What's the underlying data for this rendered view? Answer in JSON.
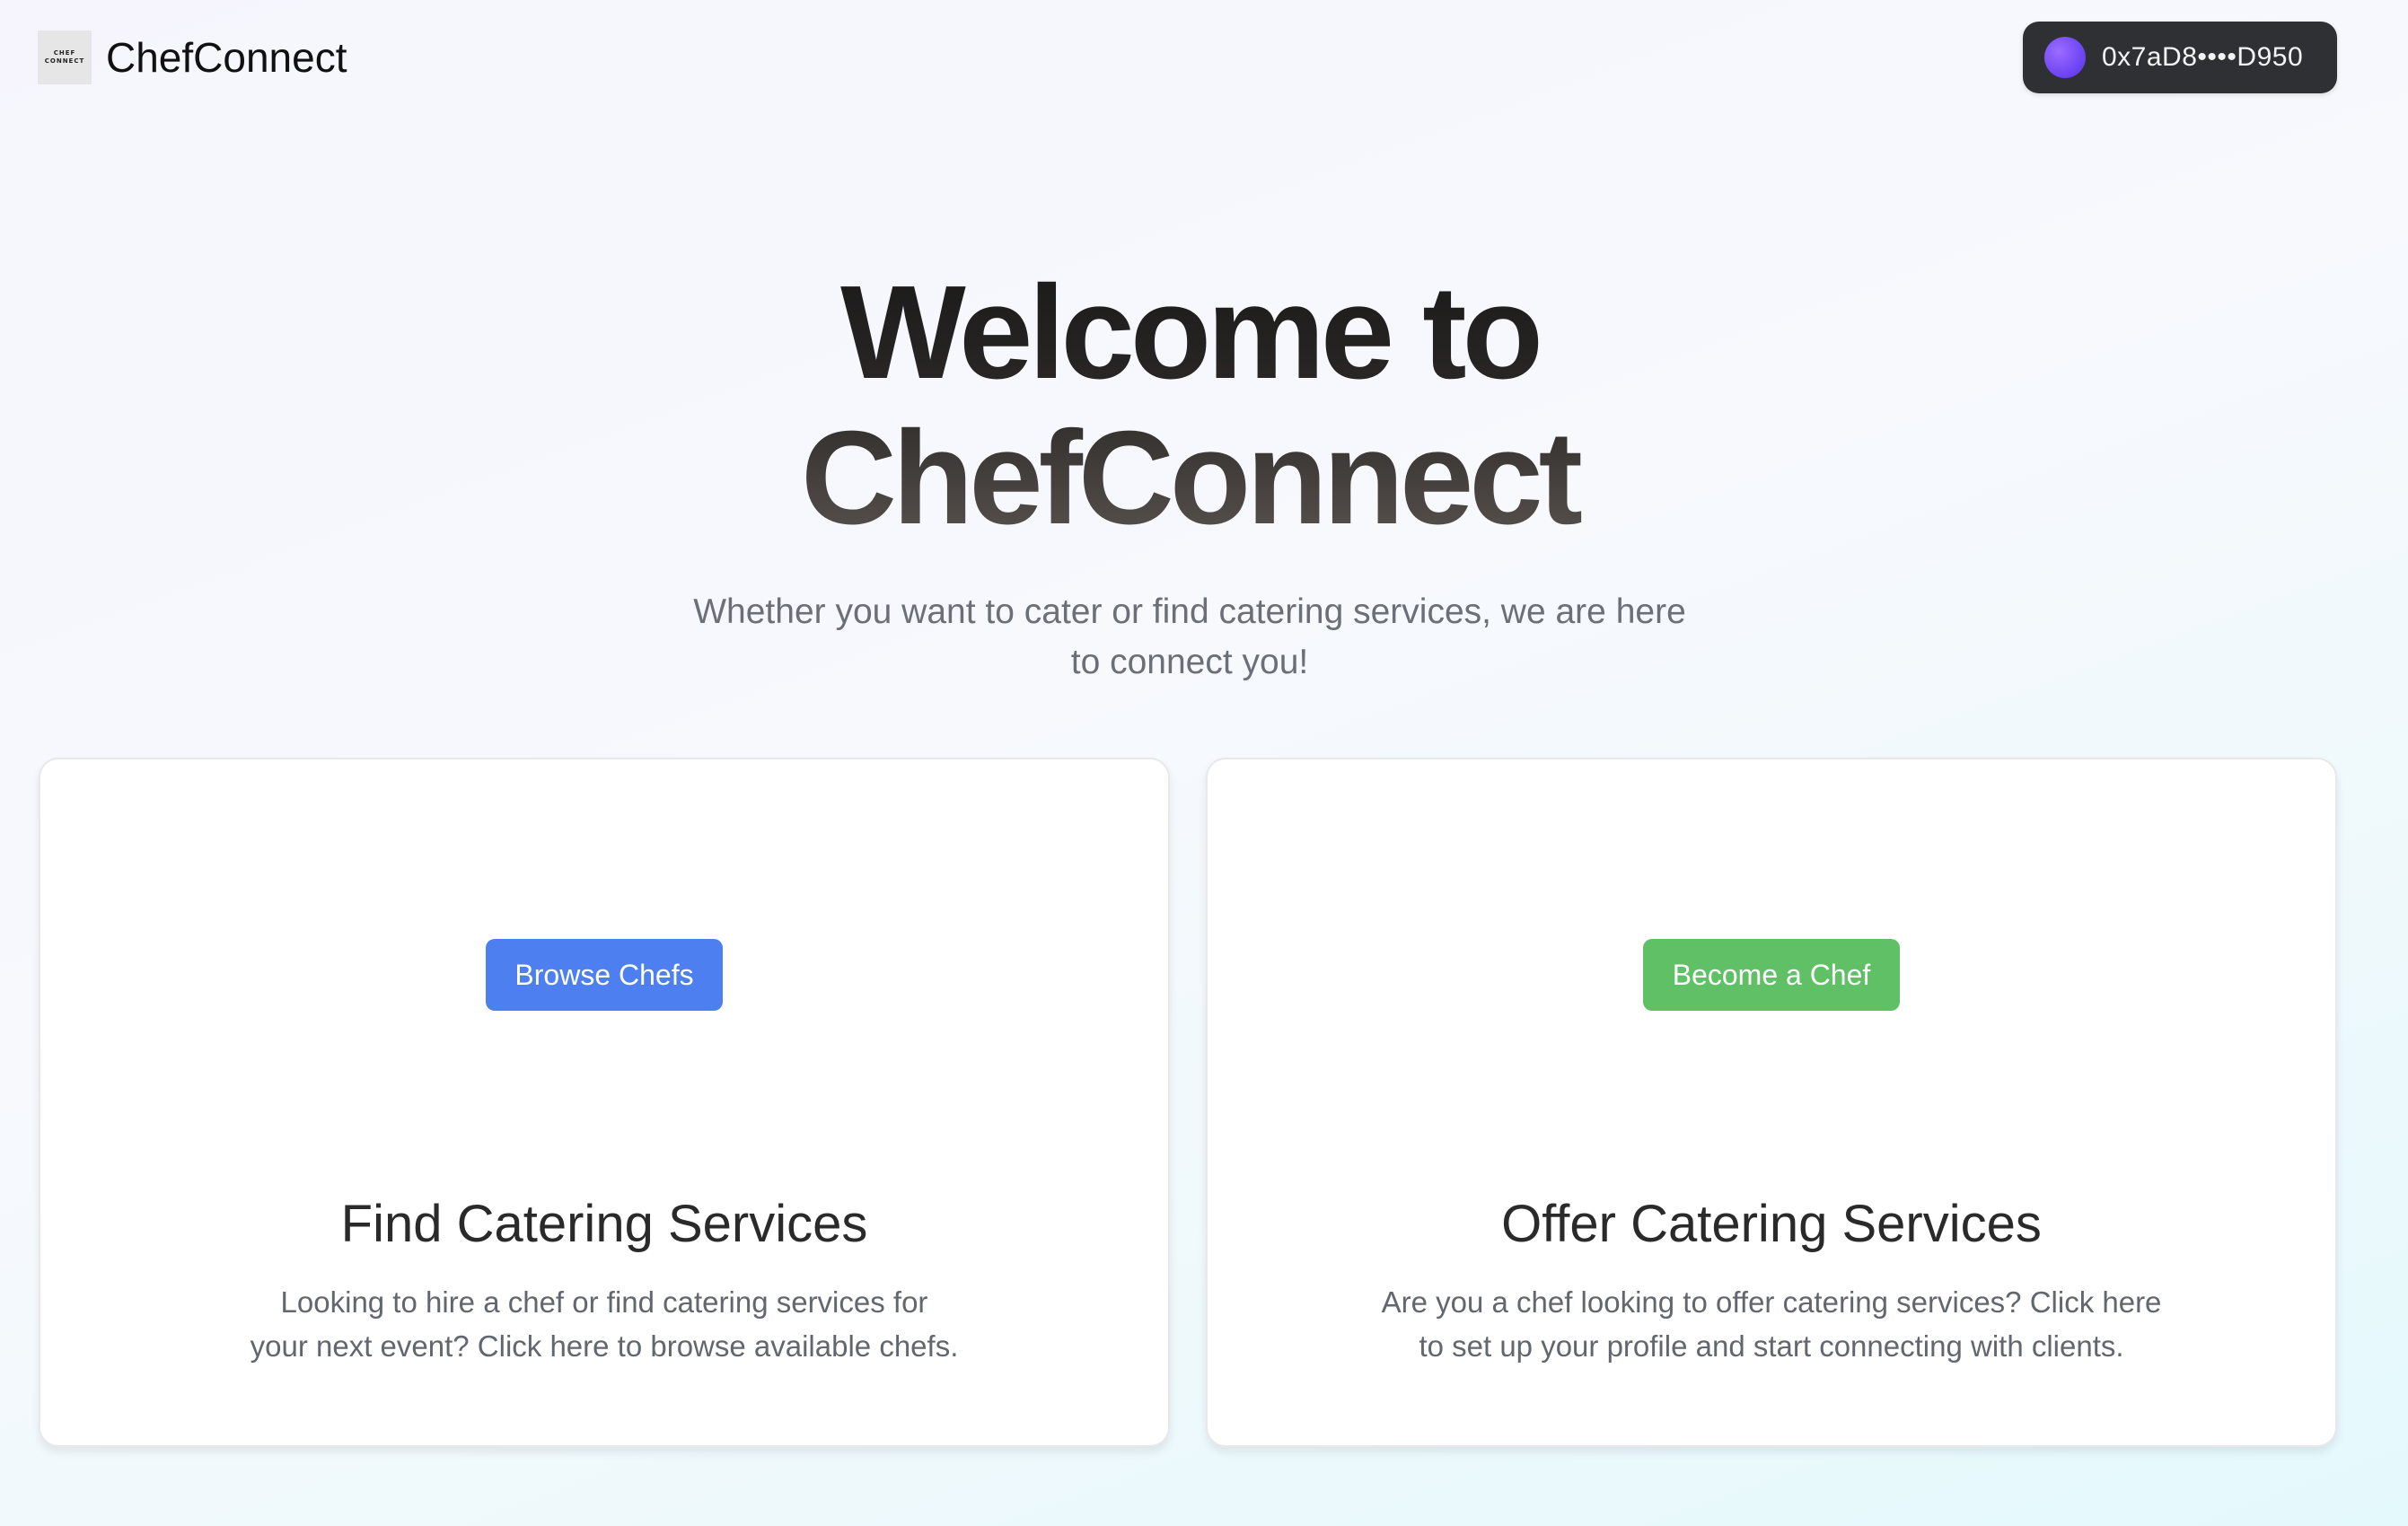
{
  "header": {
    "logo_line1": "CHEF",
    "logo_line2": "CONNECT",
    "brand": "ChefConnect",
    "wallet_address": "0x7aD8••••D950"
  },
  "hero": {
    "title_line1": "Welcome to",
    "title_line2": "ChefConnect",
    "subtitle_line1": "Whether you want to cater or find catering services, we are here",
    "subtitle_line2": "to connect you!"
  },
  "cards": [
    {
      "button_label": "Browse Chefs",
      "title": "Find Catering Services",
      "desc_line1": "Looking to hire a chef or find catering services for",
      "desc_line2": "your next event? Click here to browse available chefs."
    },
    {
      "button_label": "Become a Chef",
      "title": "Offer Catering Services",
      "desc_line1": "Are you a chef looking to offer catering services? Click here",
      "desc_line2": "to set up your profile and start connecting with clients."
    }
  ],
  "colors": {
    "browse_button": "#4e7ff0",
    "become_button": "#5fc066",
    "wallet_bg": "#2f3033"
  }
}
